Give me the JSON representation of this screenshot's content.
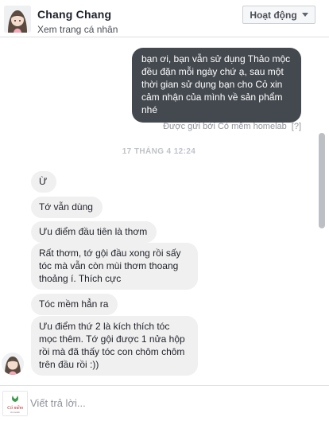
{
  "header": {
    "contact_name": "Chang Chang",
    "view_profile": "Xem trang cá nhân",
    "actions_label": "Hoạt động"
  },
  "thread": {
    "sent_message": "bạn ơi, bạn vẫn sử dụng Thảo mộc đều đặn mỗi ngày chứ ạ, sau một thời gian sử dụng bạn cho Cỏ xin cảm nhận của mình về sản phẩm nhé",
    "sent_by": "Được gửi bởi Cỏ mềm homelab",
    "sent_by_help": "[?]",
    "timestamp": "17 THÁNG 4 12:24",
    "received": [
      "Ừ",
      "Tớ vẫn dùng",
      "Ưu điểm đầu tiên là thơm",
      "Rất thơm, tớ gội đầu xong rồi sấy tóc mà vẫn còn mùi thơm thoang thoảng í. Thích cực",
      "Tóc mềm hẳn ra",
      "Ưu điểm thứ 2 là kích thích tóc mọc thêm. Tớ gội được 1 nửa hộp rồi mà đã thấy tóc con chôm chôm trên đầu rồi :))"
    ]
  },
  "composer": {
    "placeholder": "Viết trả lời...",
    "page_logo_text": "Cỏ mềm",
    "page_logo_sub": "Homelab"
  },
  "colors": {
    "sent_bubble": "#444950",
    "received_bubble": "#f1f0f0",
    "meta_text": "#90949c"
  }
}
